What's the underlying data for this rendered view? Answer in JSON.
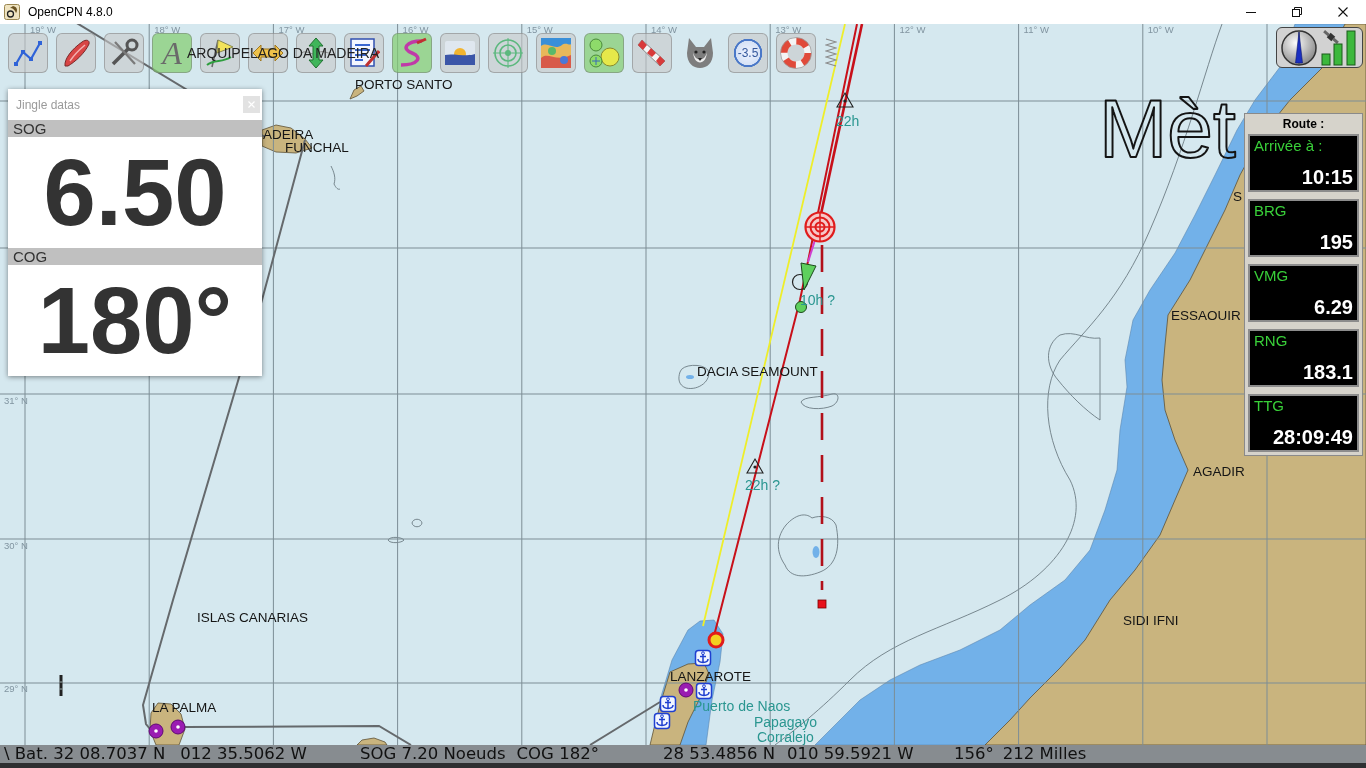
{
  "window": {
    "title": "OpenCPN 4.8.0"
  },
  "toolbar": [
    {
      "kind": "route",
      "on": false
    },
    {
      "kind": "boat",
      "on": false
    },
    {
      "kind": "tools",
      "on": false
    },
    {
      "kind": "text",
      "glyph": "A",
      "on": true
    },
    {
      "kind": "mark",
      "on": false
    },
    {
      "kind": "zoom-width",
      "on": false
    },
    {
      "kind": "zoom-height",
      "on": false
    },
    {
      "kind": "settings",
      "on": false
    },
    {
      "kind": "track",
      "on": true
    },
    {
      "kind": "tide",
      "on": false
    },
    {
      "kind": "ais",
      "on": false
    },
    {
      "kind": "grib",
      "on": false
    },
    {
      "kind": "dashboard",
      "on": true
    },
    {
      "kind": "windsock",
      "on": false
    },
    {
      "kind": "plugin",
      "on": false
    },
    {
      "kind": "variation",
      "glyph": "-3.5",
      "on": false
    },
    {
      "kind": "lifebuoy",
      "on": false
    },
    {
      "kind": "grip",
      "on": false
    }
  ],
  "chart": {
    "overlay_text": "Mèt",
    "longitude_labels": [
      "19° W",
      "18° W",
      "17° W",
      "16° W",
      "15° W",
      "14° W",
      "13° W",
      "12° W",
      "11° W",
      "10° W"
    ],
    "latitude_labels": [
      "31° N",
      "30° N",
      "29° N"
    ],
    "place_labels": [
      "ARQUIPELAGO DA MADEIRA",
      "PORTO SANTO",
      "ADEIRA",
      "FUNCHAL",
      "S",
      "ESSAOUIR",
      "DACIA SEAMOUNT",
      "AGADIR",
      "ISLAS CANARIAS",
      "SIDI IFNI",
      "LANZAROTE",
      "LA PALMA"
    ],
    "marker_labels": [
      "22h",
      "10h ?",
      "22h ?",
      "Puerto de Naos",
      "Papagayo",
      "Corralejo"
    ]
  },
  "jingle_panel": {
    "title": "Jingle datas",
    "items": [
      {
        "label": "SOG",
        "value": "6.50"
      },
      {
        "label": "COG",
        "value": "180°"
      }
    ]
  },
  "route_panel": {
    "title": "Route :",
    "items": [
      {
        "label": "Arrivée à :",
        "value": "10:15"
      },
      {
        "label": "BRG",
        "value": "195"
      },
      {
        "label": "VMG",
        "value": "6.29"
      },
      {
        "label": "RNG",
        "value": "183.1"
      },
      {
        "label": "TTG",
        "value": "28:09:49"
      }
    ]
  },
  "status_bar": {
    "panes": [
      [
        "\\ Bat. 32 08.7037 N",
        "012 35.5062 W"
      ],
      [
        "SOG 7.20 Noeuds",
        "COG 182°"
      ],
      [
        "28 53.4856 N",
        "010 59.5921 W"
      ],
      [
        "156°",
        "212 Milles"
      ]
    ]
  }
}
